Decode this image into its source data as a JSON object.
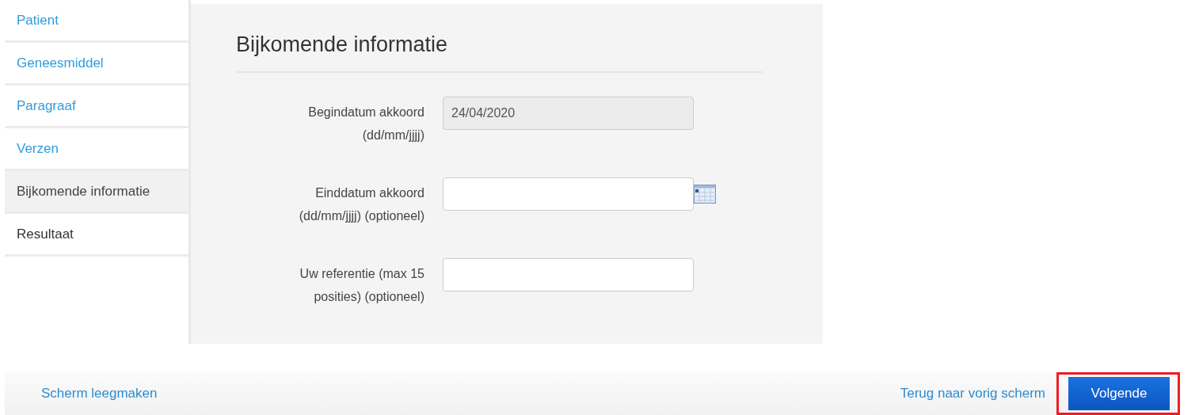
{
  "sidebar": {
    "items": [
      {
        "label": "Patient",
        "selected": false,
        "done": true
      },
      {
        "label": "Geneesmiddel",
        "selected": false,
        "done": true
      },
      {
        "label": "Paragraaf",
        "selected": false,
        "done": true
      },
      {
        "label": "Verzen",
        "selected": false,
        "done": true
      },
      {
        "label": "Bijkomende informatie",
        "selected": true,
        "done": false
      },
      {
        "label": "Resultaat",
        "selected": false,
        "done": false
      }
    ]
  },
  "form": {
    "title": "Bijkomende informatie",
    "fields": [
      {
        "label_lines": [
          "Begindatum akkoord",
          "(dd/mm/jjjj)"
        ],
        "value": "24/04/2020",
        "disabled": true,
        "calendar_button": false
      },
      {
        "label_lines": [
          "Einddatum akkoord",
          "(dd/mm/jjjj) (optioneel)"
        ],
        "disabled": false,
        "calendar_button": true
      },
      {
        "label_lines": [
          "Uw referentie (max 15",
          "posities) (optioneel)"
        ],
        "disabled": false,
        "calendar_button": false
      }
    ]
  },
  "footer": {
    "clear_link": "Scherm leegmaken",
    "back_link": "Terug naar vorig scherm",
    "next_button": {
      "label": "Volgende",
      "highlighted": true
    }
  }
}
